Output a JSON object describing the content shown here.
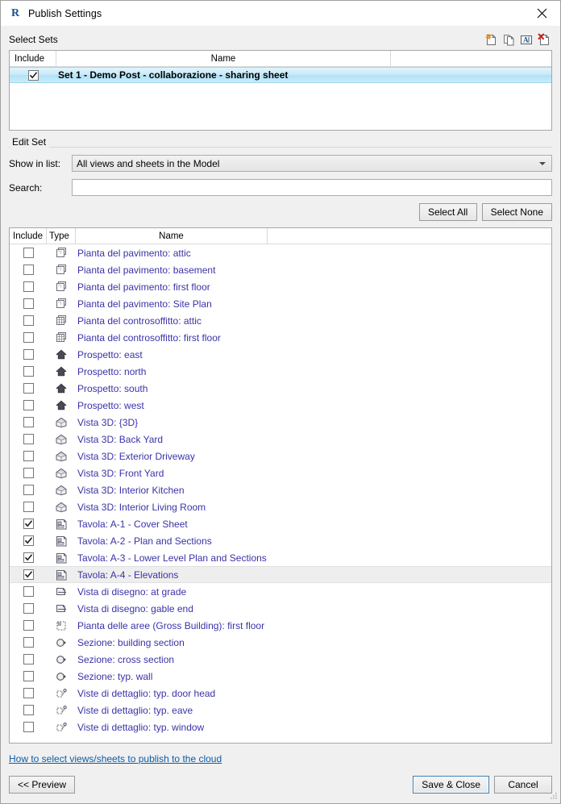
{
  "window": {
    "title": "Publish Settings",
    "logo_icon": "revit-r-logo",
    "close_icon": "close-icon"
  },
  "select_sets": {
    "label": "Select Sets",
    "tools": [
      {
        "name": "new-set-icon",
        "tooltip": "New"
      },
      {
        "name": "duplicate-set-icon",
        "tooltip": "Duplicate"
      },
      {
        "name": "rename-set-icon",
        "tooltip": "Rename"
      },
      {
        "name": "delete-set-icon",
        "tooltip": "Delete"
      }
    ],
    "columns": [
      "Include",
      "Name"
    ],
    "rows": [
      {
        "checked": true,
        "name": "Set 1 - Demo Post - collaborazione - sharing sheet",
        "selected": true
      }
    ]
  },
  "edit_set": {
    "label": "Edit Set",
    "show_in_list_label": "Show in list:",
    "show_in_list_value": "All views and sheets in the Model",
    "search_label": "Search:",
    "search_value": "",
    "search_placeholder": "",
    "select_all_label": "Select All",
    "select_none_label": "Select None"
  },
  "views_table": {
    "columns": [
      "Include",
      "Type",
      "Name"
    ],
    "rows": [
      {
        "checked": false,
        "icon": "floor-plan-icon",
        "name": "Pianta del pavimento: attic"
      },
      {
        "checked": false,
        "icon": "floor-plan-icon",
        "name": "Pianta del pavimento: basement"
      },
      {
        "checked": false,
        "icon": "floor-plan-icon",
        "name": "Pianta del pavimento: first floor"
      },
      {
        "checked": false,
        "icon": "floor-plan-icon",
        "name": "Pianta del pavimento: Site Plan"
      },
      {
        "checked": false,
        "icon": "ceiling-plan-icon",
        "name": "Pianta del controsoffitto: attic"
      },
      {
        "checked": false,
        "icon": "ceiling-plan-icon",
        "name": "Pianta del controsoffitto: first floor"
      },
      {
        "checked": false,
        "icon": "elevation-icon",
        "name": "Prospetto: east"
      },
      {
        "checked": false,
        "icon": "elevation-icon",
        "name": "Prospetto: north"
      },
      {
        "checked": false,
        "icon": "elevation-icon",
        "name": "Prospetto: south"
      },
      {
        "checked": false,
        "icon": "elevation-icon",
        "name": "Prospetto: west"
      },
      {
        "checked": false,
        "icon": "view-3d-icon",
        "name": "Vista 3D: {3D}"
      },
      {
        "checked": false,
        "icon": "view-3d-icon",
        "name": "Vista 3D: Back Yard"
      },
      {
        "checked": false,
        "icon": "view-3d-icon",
        "name": "Vista 3D: Exterior Driveway"
      },
      {
        "checked": false,
        "icon": "view-3d-icon",
        "name": "Vista 3D: Front Yard"
      },
      {
        "checked": false,
        "icon": "view-3d-icon",
        "name": "Vista 3D: Interior Kitchen"
      },
      {
        "checked": false,
        "icon": "view-3d-icon",
        "name": "Vista 3D: Interior Living Room"
      },
      {
        "checked": true,
        "icon": "sheet-icon",
        "name": "Tavola: A-1 - Cover Sheet"
      },
      {
        "checked": true,
        "icon": "sheet-icon",
        "name": "Tavola: A-2 - Plan and Sections"
      },
      {
        "checked": true,
        "icon": "sheet-icon",
        "name": "Tavola: A-3 - Lower Level Plan and Sections"
      },
      {
        "checked": true,
        "icon": "sheet-icon",
        "name": "Tavola: A-4 - Elevations",
        "highlight": true
      },
      {
        "checked": false,
        "icon": "drafting-view-icon",
        "name": "Vista di disegno: at grade"
      },
      {
        "checked": false,
        "icon": "drafting-view-icon",
        "name": "Vista di disegno: gable end"
      },
      {
        "checked": false,
        "icon": "area-plan-icon",
        "name": "Pianta delle aree (Gross Building): first floor"
      },
      {
        "checked": false,
        "icon": "section-icon",
        "name": "Sezione: building section"
      },
      {
        "checked": false,
        "icon": "section-icon",
        "name": "Sezione: cross section"
      },
      {
        "checked": false,
        "icon": "section-icon",
        "name": "Sezione: typ. wall"
      },
      {
        "checked": false,
        "icon": "detail-view-icon",
        "name": "Viste di dettaglio: typ. door head"
      },
      {
        "checked": false,
        "icon": "detail-view-icon",
        "name": "Viste di dettaglio: typ. eave"
      },
      {
        "checked": false,
        "icon": "detail-view-icon",
        "name": "Viste di dettaglio: typ. window"
      }
    ]
  },
  "footer": {
    "help_link": "How to select views/sheets to publish to the cloud",
    "preview_label": "<< Preview",
    "save_close_label": "Save & Close",
    "cancel_label": "Cancel"
  },
  "colors": {
    "link": "#0b5ca8",
    "view_name": "#3b32a8",
    "selection_blue": "#b0e1f6",
    "default_button_border": "#3c7fb1",
    "window_bg": "#f0f0f0"
  }
}
